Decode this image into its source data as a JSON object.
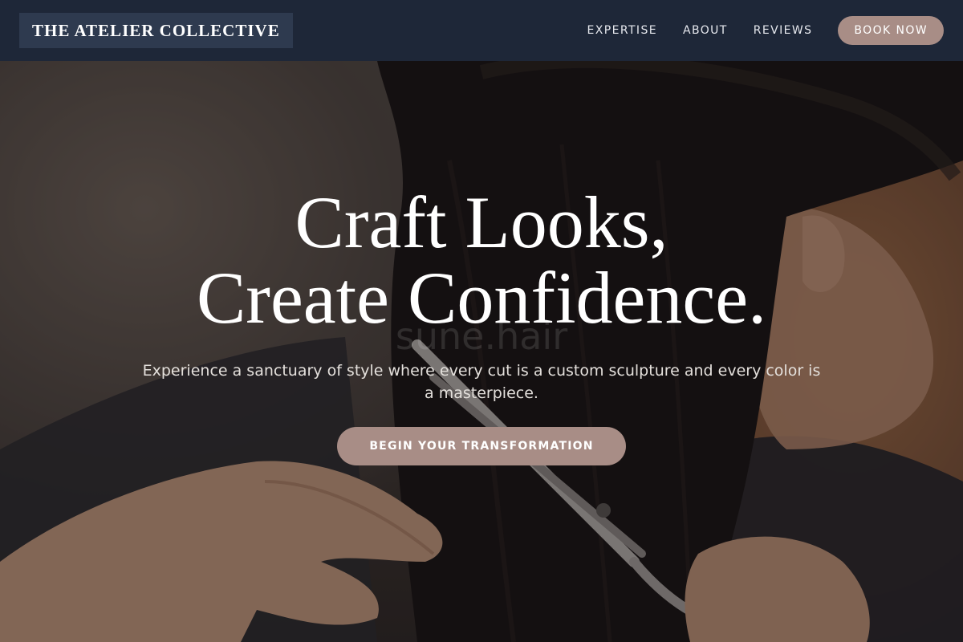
{
  "header": {
    "brand": "THE ATELIER COLLECTIVE",
    "nav": [
      {
        "label": "EXPERTISE"
      },
      {
        "label": "ABOUT"
      },
      {
        "label": "REVIEWS"
      }
    ],
    "book_label": "BOOK NOW"
  },
  "hero": {
    "headline_line1": "Craft Looks,",
    "headline_line2": "Create Confidence.",
    "watermark": "sune.hair",
    "subtext": "Experience a sanctuary of style where every cut is a custom sculpture and every color is a masterpiece.",
    "cta_label": "BEGIN YOUR TRANSFORMATION",
    "background_image": "hair-stylist-cutting-hair-photo"
  },
  "colors": {
    "nav_bg": "#1e2738",
    "brand_bg": "#2e3a4f",
    "accent": "#a88d86",
    "text_light": "#ffffff"
  }
}
